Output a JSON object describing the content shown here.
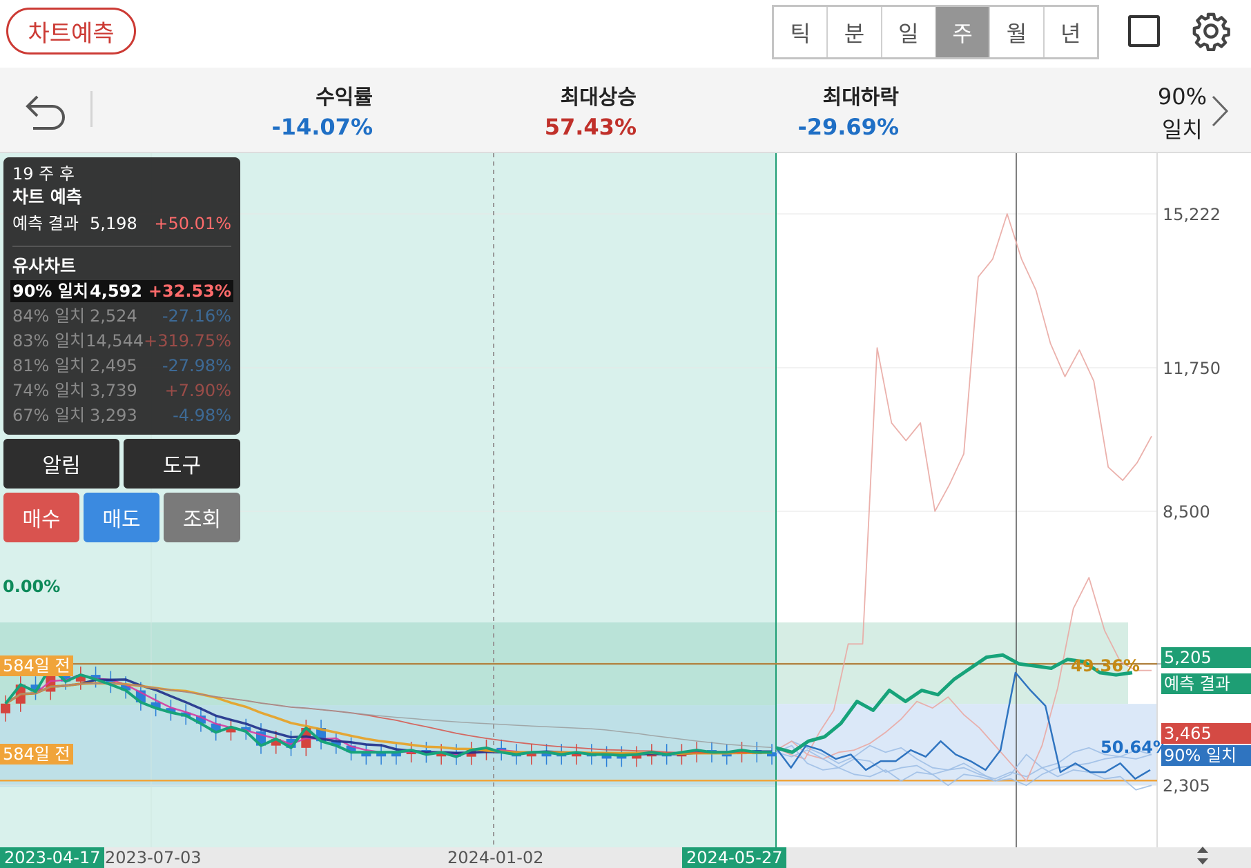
{
  "header": {
    "predict_button": "차트예측",
    "tabs": [
      {
        "label": "틱",
        "active": false
      },
      {
        "label": "분",
        "active": false
      },
      {
        "label": "일",
        "active": false
      },
      {
        "label": "주",
        "active": true
      },
      {
        "label": "월",
        "active": false
      },
      {
        "label": "년",
        "active": false
      }
    ]
  },
  "stats": {
    "return_label": "수익률",
    "return_value": "-14.07%",
    "max_rise_label": "최대상승",
    "max_rise_value": "57.43%",
    "max_fall_label": "최대하락",
    "max_fall_value": "-29.69%",
    "match_pct": "90%",
    "match_label": "일치",
    "colors": {
      "negative": "#1f6fc5",
      "positive": "#c0302a"
    }
  },
  "info_panel": {
    "horizon": "19 주 후",
    "predict_title": "차트 예측",
    "predict_label": "예측 결과",
    "predict_value": "5,198",
    "predict_pct": "+50.01%",
    "similar_title": "유사차트",
    "similar": [
      {
        "label": "90% 일치",
        "value": "4,592",
        "pct": "+32.53%",
        "selected": true
      },
      {
        "label": "84% 일치",
        "value": "2,524",
        "pct": "-27.16%",
        "selected": false
      },
      {
        "label": "83% 일치",
        "value": "14,544",
        "pct": "+319.75%",
        "selected": false
      },
      {
        "label": "81% 일치",
        "value": "2,495",
        "pct": "-27.98%",
        "selected": false
      },
      {
        "label": "74% 일치",
        "value": "3,739",
        "pct": "+7.90%",
        "selected": false
      },
      {
        "label": "67% 일치",
        "value": "3,293",
        "pct": "-4.98%",
        "selected": false
      }
    ]
  },
  "actions": {
    "alert": "알림",
    "tool": "도구",
    "buy": "매수",
    "sell": "매도",
    "query": "조회"
  },
  "chart_labels": {
    "zero_pct": "0.00%",
    "upper_line_tag": "584일 전",
    "lower_line_tag": "584일 전",
    "predict_pct_label": "49.36%",
    "similar_pct_label": "50.64%",
    "price_tag_prediction": "5,205",
    "price_tag_prediction_caption": "예측 결과",
    "price_tag_similar": "3,465",
    "price_tag_similar_caption": "90% 일치"
  },
  "chart_data": {
    "type": "line",
    "title": "",
    "y_axis_ticks": [
      15222,
      11750,
      8500,
      2305
    ],
    "y_axis_tick_labels": [
      "15,222",
      "11,750",
      "8,500",
      "2,305"
    ],
    "ylim": [
      1700,
      16000
    ],
    "x_axis_labels": [
      "2023-04-17",
      "2023-07-03",
      "2024-01-02",
      "2024-05-27"
    ],
    "highlighted_dates": [
      "2023-04-17",
      "2024-05-27"
    ],
    "grid": true,
    "reference_lines": [
      {
        "name": "584일 전",
        "value": 5050
      },
      {
        "name": "584일 전",
        "value": 2410
      }
    ],
    "series": [
      {
        "name": "",
        "kind": "history-close",
        "values": [
          4150,
          4580,
          4420,
          4980,
          4650,
          4800,
          4700,
          4580,
          4450,
          4180,
          4050,
          3950,
          3880,
          3700,
          3500,
          3620,
          3520,
          3200,
          3350,
          3150,
          3600,
          3300,
          3200,
          3050,
          3050,
          3050,
          3050,
          3100,
          3000,
          3050,
          2950,
          3100,
          3150,
          3050,
          3000,
          3050,
          3050,
          3000,
          3050,
          3000,
          3000,
          2980,
          3000,
          3050,
          3000,
          3050,
          3100,
          3050,
          3050,
          3100,
          3050,
          3050
        ]
      },
      {
        "name": "예측 결과",
        "kind": "prediction",
        "values": [
          3150,
          3050,
          3300,
          3400,
          3700,
          4200,
          4000,
          4450,
          4200,
          4450,
          4350,
          4700,
          4950,
          5200,
          5250,
          5050,
          5000,
          4950,
          5150,
          5100,
          4850,
          4800,
          4850
        ]
      },
      {
        "name": "90% 일치",
        "kind": "similar",
        "values": [
          3150,
          2700,
          3200,
          3100,
          2900,
          3000,
          2650,
          2850,
          2850,
          3100,
          2950,
          3300,
          3000,
          2850,
          2650,
          3100,
          4850,
          4450,
          4100,
          2600,
          2800,
          2600,
          2600,
          2800,
          2450,
          2650
        ]
      },
      {
        "name": "84% 일치",
        "kind": "similar-faint",
        "values": [
          3100,
          3300,
          3150,
          3000,
          2800,
          2950,
          3200,
          3050,
          3150,
          2900,
          2700,
          2650,
          2800,
          2600,
          2400,
          2550,
          3000,
          2700,
          2500,
          2650,
          2600,
          2450,
          2500,
          2200,
          2300
        ]
      },
      {
        "name": "83% 일치",
        "kind": "similar-faint",
        "values": [
          3150,
          3000,
          2900,
          3500,
          4000,
          5500,
          5500,
          12200,
          10500,
          10100,
          10500,
          8500,
          9100,
          9800,
          13800,
          14200,
          15222,
          14200,
          13500,
          12300,
          11550,
          12150,
          11450,
          9500,
          9200,
          9600,
          10200
        ]
      },
      {
        "name": "81% 일치",
        "kind": "similar-faint",
        "values": [
          3050,
          3200,
          2800,
          2650,
          2700,
          2900,
          2850,
          2600,
          2700,
          2750,
          2550,
          2650,
          2700,
          2550,
          2450,
          2600,
          2500,
          2700,
          2800,
          3050,
          3150,
          3000,
          2950,
          3100,
          3000
        ]
      },
      {
        "name": "74% 일치",
        "kind": "similar-faint",
        "values": [
          3100,
          3300,
          3000,
          2900,
          3050,
          3100,
          3250,
          3500,
          3800,
          4200,
          4050,
          4300,
          3900,
          3600,
          3200,
          2800,
          2400,
          3200,
          4500,
          6300,
          7000,
          5800,
          5100,
          4900,
          4900
        ]
      },
      {
        "name": "67% 일치",
        "kind": "similar-faint",
        "values": [
          3050,
          2950,
          3100,
          2900,
          2700,
          2550,
          2500,
          2650,
          2400,
          2600,
          2550,
          2300,
          2550,
          2500,
          2400,
          2450,
          2300,
          2550,
          2700,
          2750,
          2800,
          2900,
          2950,
          2900,
          3000
        ]
      }
    ]
  }
}
